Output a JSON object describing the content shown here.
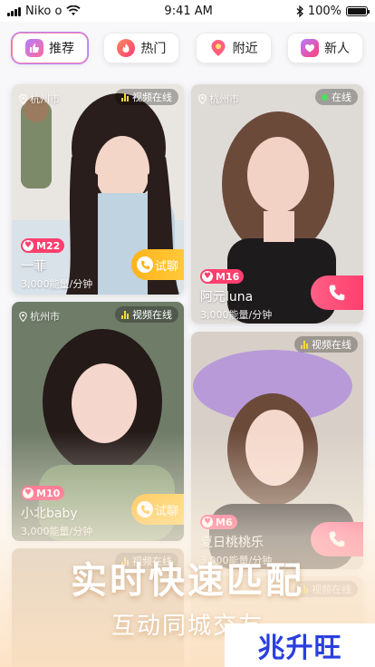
{
  "status_bar": {
    "carrier": "Niko o",
    "time": "9:41 AM",
    "battery": "100%"
  },
  "tabs": [
    {
      "label": "推荐",
      "icon": "thumbs-up-icon",
      "active": true,
      "color": "#a66cff"
    },
    {
      "label": "热门",
      "icon": "flame-icon",
      "active": false,
      "color": "#ff4f7a"
    },
    {
      "label": "附近",
      "icon": "location-pin-icon",
      "active": false,
      "color": "#ff5e7e"
    },
    {
      "label": "新人",
      "icon": "new-user-icon",
      "active": false,
      "color": "#ff3c77"
    }
  ],
  "cards": [
    {
      "location": "杭州市",
      "status": "视频在线",
      "level": "M22",
      "name": "一菲",
      "price": "3,000能量/分钟",
      "action": "试聊"
    },
    {
      "location": "杭州市",
      "status": "在线",
      "level": "M16",
      "name": "阿元luna",
      "price": "3,000能量/分钟",
      "action": "call"
    },
    {
      "location": "杭州市",
      "status": "视频在线",
      "level": "M10",
      "name": "小北baby",
      "price": "3,000能量/分钟",
      "action": "试聊"
    },
    {
      "location": "",
      "status": "视频在线",
      "level": "M6",
      "name": "夏日桃桃乐",
      "price": "3,000能量/分钟",
      "action": "call"
    },
    {
      "location": "",
      "status": "视频在线",
      "level": "",
      "name": "",
      "price": "",
      "action": ""
    },
    {
      "location": "",
      "status": "视频在线",
      "level": "",
      "name": "",
      "price": "",
      "action": ""
    }
  ],
  "promo": {
    "title": "实时快速匹配",
    "subtitle": "互动同城交友"
  },
  "logo": {
    "text": "兆升旺"
  },
  "colors": {
    "accent_pink": "#ff3f6e",
    "try_orange": "#ffb31a"
  }
}
